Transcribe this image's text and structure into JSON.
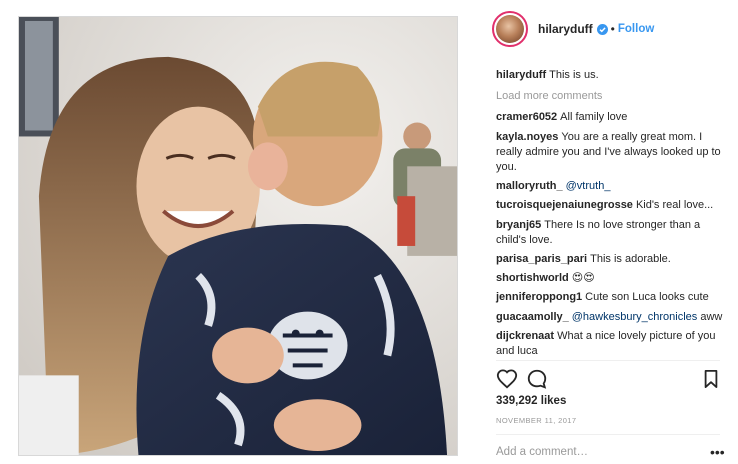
{
  "post": {
    "author": "hilaryduff",
    "verified": true,
    "follow_label": "Follow",
    "separator": "•",
    "caption_user": "hilaryduff",
    "caption_text": "This is us.",
    "load_more": "Load more comments",
    "likes": "339,292 likes",
    "date": "NOVEMBER 11, 2017",
    "add_comment_placeholder": "Add a comment…",
    "more_icon": "•••"
  },
  "comments": [
    {
      "user": "cramer6052",
      "text": "All family love"
    },
    {
      "user": "kayla.noyes",
      "text": "You are a really great mom. I really admire you and I've always looked up to you."
    },
    {
      "user": "malloryruth_",
      "mention": "@vtruth_",
      "text": ""
    },
    {
      "user": "tucroisquejenaiunegrosse",
      "text": "Kid's real love..."
    },
    {
      "user": "bryanj65",
      "text": "There Is no love stronger than a child's love."
    },
    {
      "user": "parisa_paris_pari",
      "text": "This is adorable."
    },
    {
      "user": "shortishworld",
      "text": "😍😍"
    },
    {
      "user": "jenniferoppong1",
      "text": "Cute son Luca looks cute"
    },
    {
      "user": "guacaamolly_",
      "mention": "@hawkesbury_chronicles",
      "text": "aww"
    },
    {
      "user": "dijckrenaat",
      "text": "What a nice lovely picture of you and luca"
    }
  ],
  "icons": {
    "like": "heart-icon",
    "comment": "comment-icon",
    "save": "bookmark-icon",
    "verified": "verified-badge-icon"
  },
  "colors": {
    "accent": "#3897f0",
    "text": "#262626",
    "muted": "#999999",
    "mention": "#003569",
    "story_ring": "#e1306c"
  }
}
